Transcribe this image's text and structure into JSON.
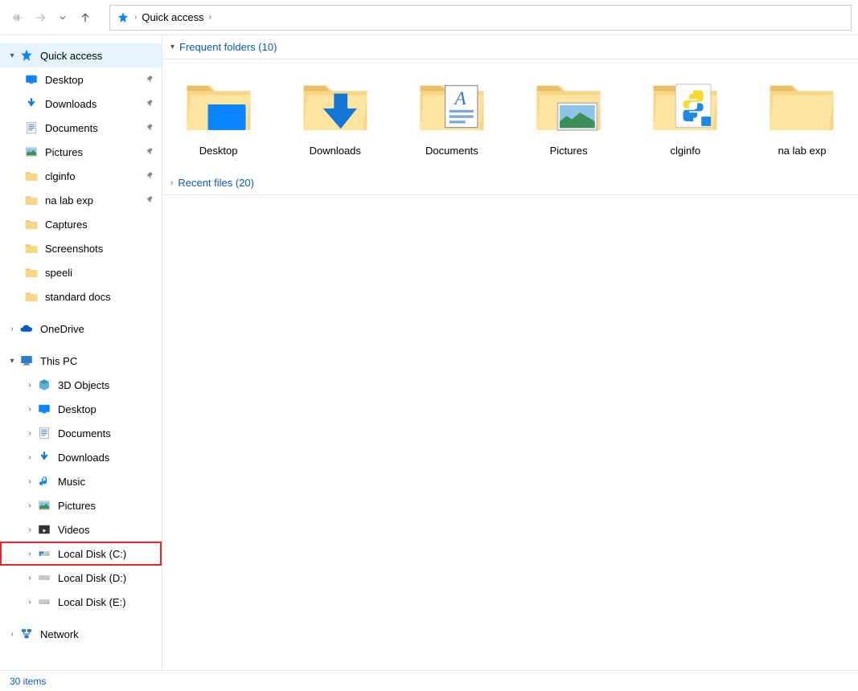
{
  "nav": {
    "breadcrumb": [
      "Quick access"
    ]
  },
  "sidebar": {
    "quick_access": {
      "label": "Quick access",
      "items": [
        {
          "label": "Desktop",
          "pinned": true,
          "icon": "desktop"
        },
        {
          "label": "Downloads",
          "pinned": true,
          "icon": "downloads"
        },
        {
          "label": "Documents",
          "pinned": true,
          "icon": "documents"
        },
        {
          "label": "Pictures",
          "pinned": true,
          "icon": "pictures"
        },
        {
          "label": "clginfo",
          "pinned": true,
          "icon": "folder"
        },
        {
          "label": "na lab exp",
          "pinned": true,
          "icon": "folder"
        },
        {
          "label": "Captures",
          "pinned": false,
          "icon": "folder"
        },
        {
          "label": "Screenshots",
          "pinned": false,
          "icon": "folder"
        },
        {
          "label": "speeli",
          "pinned": false,
          "icon": "folder"
        },
        {
          "label": "standard docs",
          "pinned": false,
          "icon": "folder"
        }
      ]
    },
    "onedrive": {
      "label": "OneDrive"
    },
    "this_pc": {
      "label": "This PC",
      "items": [
        {
          "label": "3D Objects",
          "icon": "3d"
        },
        {
          "label": "Desktop",
          "icon": "desktop"
        },
        {
          "label": "Documents",
          "icon": "documents"
        },
        {
          "label": "Downloads",
          "icon": "downloads"
        },
        {
          "label": "Music",
          "icon": "music"
        },
        {
          "label": "Pictures",
          "icon": "pictures"
        },
        {
          "label": "Videos",
          "icon": "videos"
        },
        {
          "label": "Local Disk (C:)",
          "icon": "drive-c",
          "highlighted": true
        },
        {
          "label": "Local Disk (D:)",
          "icon": "drive"
        },
        {
          "label": "Local Disk (E:)",
          "icon": "drive"
        }
      ]
    },
    "network": {
      "label": "Network"
    }
  },
  "content": {
    "frequent_folders": {
      "header": "Frequent folders (10)",
      "items": [
        {
          "label": "Desktop",
          "icon": "desktop"
        },
        {
          "label": "Downloads",
          "icon": "downloads"
        },
        {
          "label": "Documents",
          "icon": "documents"
        },
        {
          "label": "Pictures",
          "icon": "pictures"
        },
        {
          "label": "clginfo",
          "icon": "python"
        },
        {
          "label": "na lab exp",
          "icon": "folder"
        }
      ]
    },
    "recent_files": {
      "header": "Recent files (20)"
    }
  },
  "status": {
    "items_label": "30 items"
  }
}
